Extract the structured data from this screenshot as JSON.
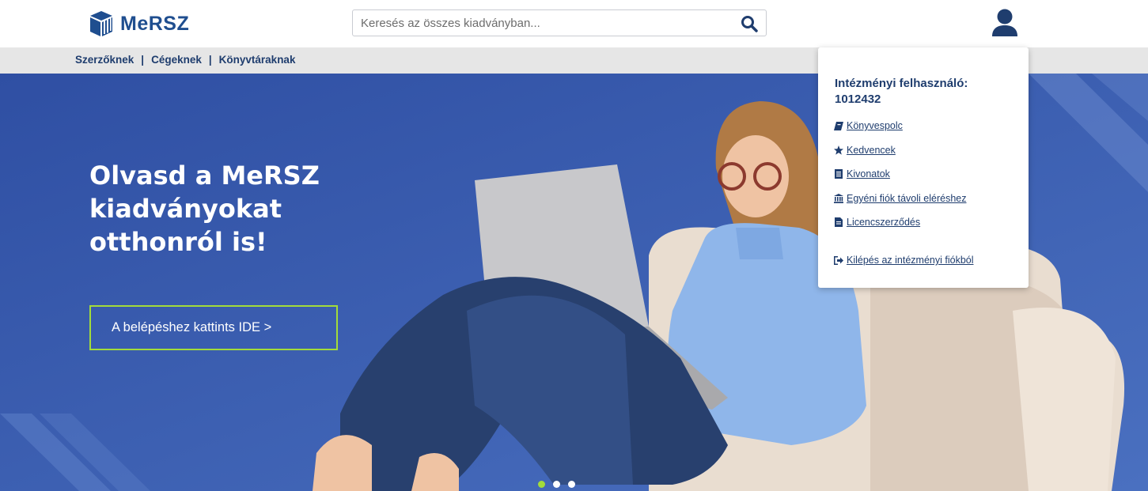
{
  "header": {
    "logo_text": "MeRSZ",
    "search": {
      "placeholder": "Keresés az összes kiadványban..."
    }
  },
  "subnav": {
    "items": [
      {
        "label": "Szerzőknek"
      },
      {
        "label": "Cégeknek"
      },
      {
        "label": "Könyvtáraknak"
      }
    ],
    "separator": "|"
  },
  "hero": {
    "heading": "Olvasd a MeRSZ kiadványokat otthonról is!",
    "cta_label": "A belépéshez kattints IDE >"
  },
  "carousel": {
    "dot_count": 3,
    "active_index": 0
  },
  "dropdown": {
    "title": "Intézményi felhasználó: 1012432",
    "items": [
      {
        "label": "Könyvespolc",
        "icon": "book-icon"
      },
      {
        "label": "Kedvencek",
        "icon": "star-icon"
      },
      {
        "label": "Kivonatok",
        "icon": "list-icon"
      },
      {
        "label": "Egyéni fiók távoli eléréshez",
        "icon": "institution-icon"
      },
      {
        "label": "Licencszerződés",
        "icon": "document-icon"
      },
      {
        "label": "Kilépés az intézményi fiókból",
        "icon": "sign-out-icon"
      }
    ]
  },
  "colors": {
    "brand": "#1f4e8f",
    "hero_bg": "#3b5fae",
    "accent": "#a3dc3a",
    "subnav_bg": "#e6e6e6"
  }
}
